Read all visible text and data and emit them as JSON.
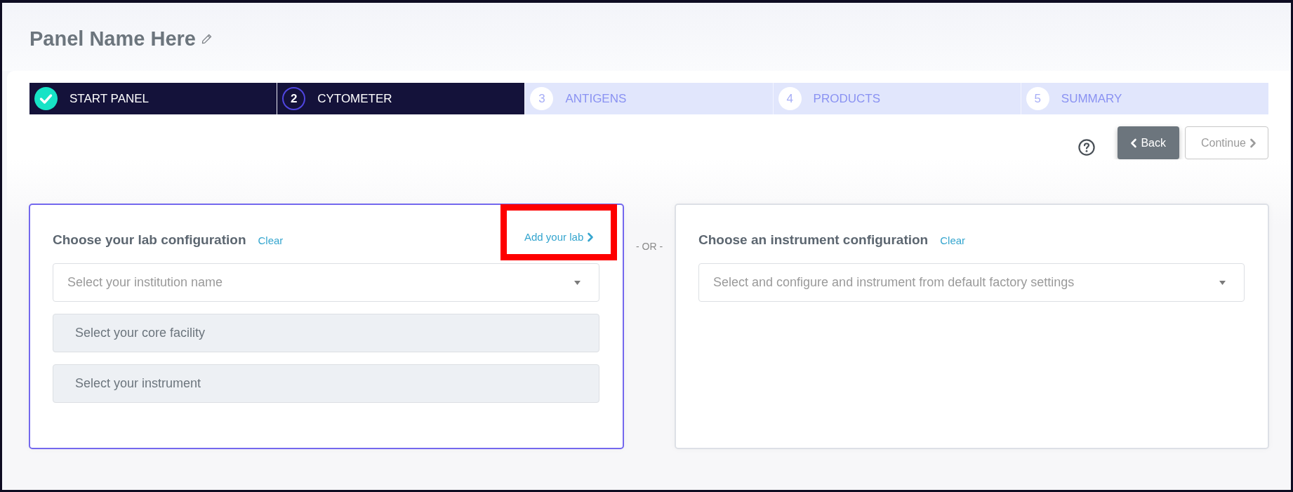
{
  "header": {
    "title": "Panel Name Here"
  },
  "stepper": {
    "steps": [
      {
        "label": "START PANEL",
        "completed": true,
        "selected": false
      },
      {
        "number": "2",
        "label": "CYTOMETER",
        "completed": false,
        "selected": true
      },
      {
        "number": "3",
        "label": "ANTIGENS",
        "completed": false,
        "selected": false
      },
      {
        "number": "4",
        "label": "PRODUCTS",
        "completed": false,
        "selected": false
      },
      {
        "number": "5",
        "label": "SUMMARY",
        "completed": false,
        "selected": false
      }
    ]
  },
  "actions": {
    "back": {
      "label": "Back"
    },
    "continue": {
      "label": "Continue",
      "disabled": true
    }
  },
  "lab_config": {
    "title": "Choose your lab configuration",
    "clear": "Clear",
    "selected": true,
    "add_link": {
      "label": "Add your lab",
      "highlighted": true
    },
    "fields": [
      {
        "placeholder": "Select your institution name",
        "disabled": false
      },
      {
        "placeholder": "Select your core facility",
        "disabled": true
      },
      {
        "placeholder": "Select your instrument",
        "disabled": true
      }
    ]
  },
  "separator": "- OR -",
  "instrument_config": {
    "title": "Choose an instrument configuration",
    "clear": "Clear",
    "selected": false,
    "fields": [
      {
        "placeholder": "Select and configure and instrument from default factory settings",
        "disabled": false
      }
    ]
  }
}
